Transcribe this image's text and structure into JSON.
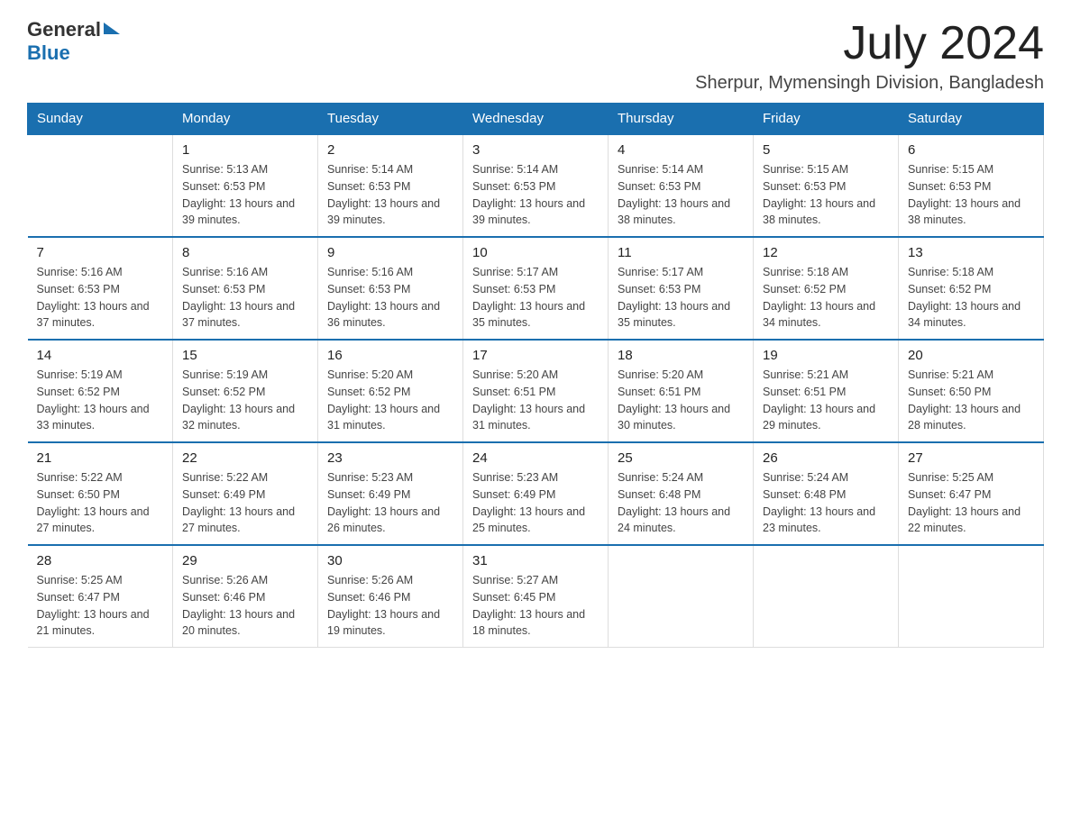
{
  "header": {
    "logo_general": "General",
    "logo_blue": "Blue",
    "month_year": "July 2024",
    "location": "Sherpur, Mymensingh Division, Bangladesh"
  },
  "days_of_week": [
    "Sunday",
    "Monday",
    "Tuesday",
    "Wednesday",
    "Thursday",
    "Friday",
    "Saturday"
  ],
  "weeks": [
    [
      {
        "day": "",
        "sunrise": "",
        "sunset": "",
        "daylight": ""
      },
      {
        "day": "1",
        "sunrise": "Sunrise: 5:13 AM",
        "sunset": "Sunset: 6:53 PM",
        "daylight": "Daylight: 13 hours and 39 minutes."
      },
      {
        "day": "2",
        "sunrise": "Sunrise: 5:14 AM",
        "sunset": "Sunset: 6:53 PM",
        "daylight": "Daylight: 13 hours and 39 minutes."
      },
      {
        "day": "3",
        "sunrise": "Sunrise: 5:14 AM",
        "sunset": "Sunset: 6:53 PM",
        "daylight": "Daylight: 13 hours and 39 minutes."
      },
      {
        "day": "4",
        "sunrise": "Sunrise: 5:14 AM",
        "sunset": "Sunset: 6:53 PM",
        "daylight": "Daylight: 13 hours and 38 minutes."
      },
      {
        "day": "5",
        "sunrise": "Sunrise: 5:15 AM",
        "sunset": "Sunset: 6:53 PM",
        "daylight": "Daylight: 13 hours and 38 minutes."
      },
      {
        "day": "6",
        "sunrise": "Sunrise: 5:15 AM",
        "sunset": "Sunset: 6:53 PM",
        "daylight": "Daylight: 13 hours and 38 minutes."
      }
    ],
    [
      {
        "day": "7",
        "sunrise": "Sunrise: 5:16 AM",
        "sunset": "Sunset: 6:53 PM",
        "daylight": "Daylight: 13 hours and 37 minutes."
      },
      {
        "day": "8",
        "sunrise": "Sunrise: 5:16 AM",
        "sunset": "Sunset: 6:53 PM",
        "daylight": "Daylight: 13 hours and 37 minutes."
      },
      {
        "day": "9",
        "sunrise": "Sunrise: 5:16 AM",
        "sunset": "Sunset: 6:53 PM",
        "daylight": "Daylight: 13 hours and 36 minutes."
      },
      {
        "day": "10",
        "sunrise": "Sunrise: 5:17 AM",
        "sunset": "Sunset: 6:53 PM",
        "daylight": "Daylight: 13 hours and 35 minutes."
      },
      {
        "day": "11",
        "sunrise": "Sunrise: 5:17 AM",
        "sunset": "Sunset: 6:53 PM",
        "daylight": "Daylight: 13 hours and 35 minutes."
      },
      {
        "day": "12",
        "sunrise": "Sunrise: 5:18 AM",
        "sunset": "Sunset: 6:52 PM",
        "daylight": "Daylight: 13 hours and 34 minutes."
      },
      {
        "day": "13",
        "sunrise": "Sunrise: 5:18 AM",
        "sunset": "Sunset: 6:52 PM",
        "daylight": "Daylight: 13 hours and 34 minutes."
      }
    ],
    [
      {
        "day": "14",
        "sunrise": "Sunrise: 5:19 AM",
        "sunset": "Sunset: 6:52 PM",
        "daylight": "Daylight: 13 hours and 33 minutes."
      },
      {
        "day": "15",
        "sunrise": "Sunrise: 5:19 AM",
        "sunset": "Sunset: 6:52 PM",
        "daylight": "Daylight: 13 hours and 32 minutes."
      },
      {
        "day": "16",
        "sunrise": "Sunrise: 5:20 AM",
        "sunset": "Sunset: 6:52 PM",
        "daylight": "Daylight: 13 hours and 31 minutes."
      },
      {
        "day": "17",
        "sunrise": "Sunrise: 5:20 AM",
        "sunset": "Sunset: 6:51 PM",
        "daylight": "Daylight: 13 hours and 31 minutes."
      },
      {
        "day": "18",
        "sunrise": "Sunrise: 5:20 AM",
        "sunset": "Sunset: 6:51 PM",
        "daylight": "Daylight: 13 hours and 30 minutes."
      },
      {
        "day": "19",
        "sunrise": "Sunrise: 5:21 AM",
        "sunset": "Sunset: 6:51 PM",
        "daylight": "Daylight: 13 hours and 29 minutes."
      },
      {
        "day": "20",
        "sunrise": "Sunrise: 5:21 AM",
        "sunset": "Sunset: 6:50 PM",
        "daylight": "Daylight: 13 hours and 28 minutes."
      }
    ],
    [
      {
        "day": "21",
        "sunrise": "Sunrise: 5:22 AM",
        "sunset": "Sunset: 6:50 PM",
        "daylight": "Daylight: 13 hours and 27 minutes."
      },
      {
        "day": "22",
        "sunrise": "Sunrise: 5:22 AM",
        "sunset": "Sunset: 6:49 PM",
        "daylight": "Daylight: 13 hours and 27 minutes."
      },
      {
        "day": "23",
        "sunrise": "Sunrise: 5:23 AM",
        "sunset": "Sunset: 6:49 PM",
        "daylight": "Daylight: 13 hours and 26 minutes."
      },
      {
        "day": "24",
        "sunrise": "Sunrise: 5:23 AM",
        "sunset": "Sunset: 6:49 PM",
        "daylight": "Daylight: 13 hours and 25 minutes."
      },
      {
        "day": "25",
        "sunrise": "Sunrise: 5:24 AM",
        "sunset": "Sunset: 6:48 PM",
        "daylight": "Daylight: 13 hours and 24 minutes."
      },
      {
        "day": "26",
        "sunrise": "Sunrise: 5:24 AM",
        "sunset": "Sunset: 6:48 PM",
        "daylight": "Daylight: 13 hours and 23 minutes."
      },
      {
        "day": "27",
        "sunrise": "Sunrise: 5:25 AM",
        "sunset": "Sunset: 6:47 PM",
        "daylight": "Daylight: 13 hours and 22 minutes."
      }
    ],
    [
      {
        "day": "28",
        "sunrise": "Sunrise: 5:25 AM",
        "sunset": "Sunset: 6:47 PM",
        "daylight": "Daylight: 13 hours and 21 minutes."
      },
      {
        "day": "29",
        "sunrise": "Sunrise: 5:26 AM",
        "sunset": "Sunset: 6:46 PM",
        "daylight": "Daylight: 13 hours and 20 minutes."
      },
      {
        "day": "30",
        "sunrise": "Sunrise: 5:26 AM",
        "sunset": "Sunset: 6:46 PM",
        "daylight": "Daylight: 13 hours and 19 minutes."
      },
      {
        "day": "31",
        "sunrise": "Sunrise: 5:27 AM",
        "sunset": "Sunset: 6:45 PM",
        "daylight": "Daylight: 13 hours and 18 minutes."
      },
      {
        "day": "",
        "sunrise": "",
        "sunset": "",
        "daylight": ""
      },
      {
        "day": "",
        "sunrise": "",
        "sunset": "",
        "daylight": ""
      },
      {
        "day": "",
        "sunrise": "",
        "sunset": "",
        "daylight": ""
      }
    ]
  ]
}
